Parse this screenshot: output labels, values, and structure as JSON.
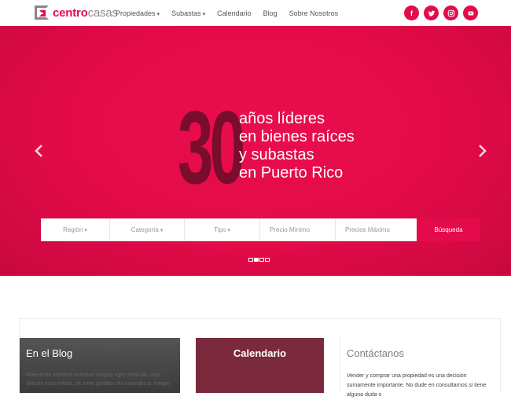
{
  "brand": {
    "part1": "centro",
    "part2": "casas"
  },
  "nav": {
    "items": [
      {
        "label": "Propiedades",
        "dropdown": true
      },
      {
        "label": "Subastas",
        "dropdown": true
      },
      {
        "label": "Calendario",
        "dropdown": false
      },
      {
        "label": "Blog",
        "dropdown": false
      },
      {
        "label": "Sobre Nosotros",
        "dropdown": false
      }
    ]
  },
  "social": [
    {
      "name": "facebook-icon",
      "glyph": "f"
    },
    {
      "name": "twitter-icon",
      "glyph": "t"
    },
    {
      "name": "instagram-icon",
      "glyph": ""
    },
    {
      "name": "youtube-icon",
      "glyph": ""
    }
  ],
  "hero": {
    "number": "30",
    "lines": [
      "años líderes",
      "en bienes raíces",
      "y subastas",
      "en Puerto Rico"
    ]
  },
  "search": {
    "region": "Región",
    "categoria": "Categoría",
    "tipo": "Tipo",
    "precio_min": "Precio Mínimo",
    "precio_max": "Precios Máximo",
    "button": "Búsqueda"
  },
  "slider": {
    "count": 4,
    "active": 1
  },
  "blog": {
    "title": "En el Blog",
    "excerpt": "Maecenas eleifend euismod magna eget vehicula. cras ultrices eros metus, sit amet porttitor dui convallis a. Integer"
  },
  "calendar": {
    "title": "Calendario"
  },
  "contact": {
    "title": "Contáctanos",
    "text": "Vender y comprar una propiedad es una decisión sumamente importante. No dude en consultarnos si tiene alguna duda o"
  },
  "colors": {
    "accent": "#e30b4b",
    "dark_accent": "#7b2a3d",
    "big_number": "#7a0c2d"
  }
}
